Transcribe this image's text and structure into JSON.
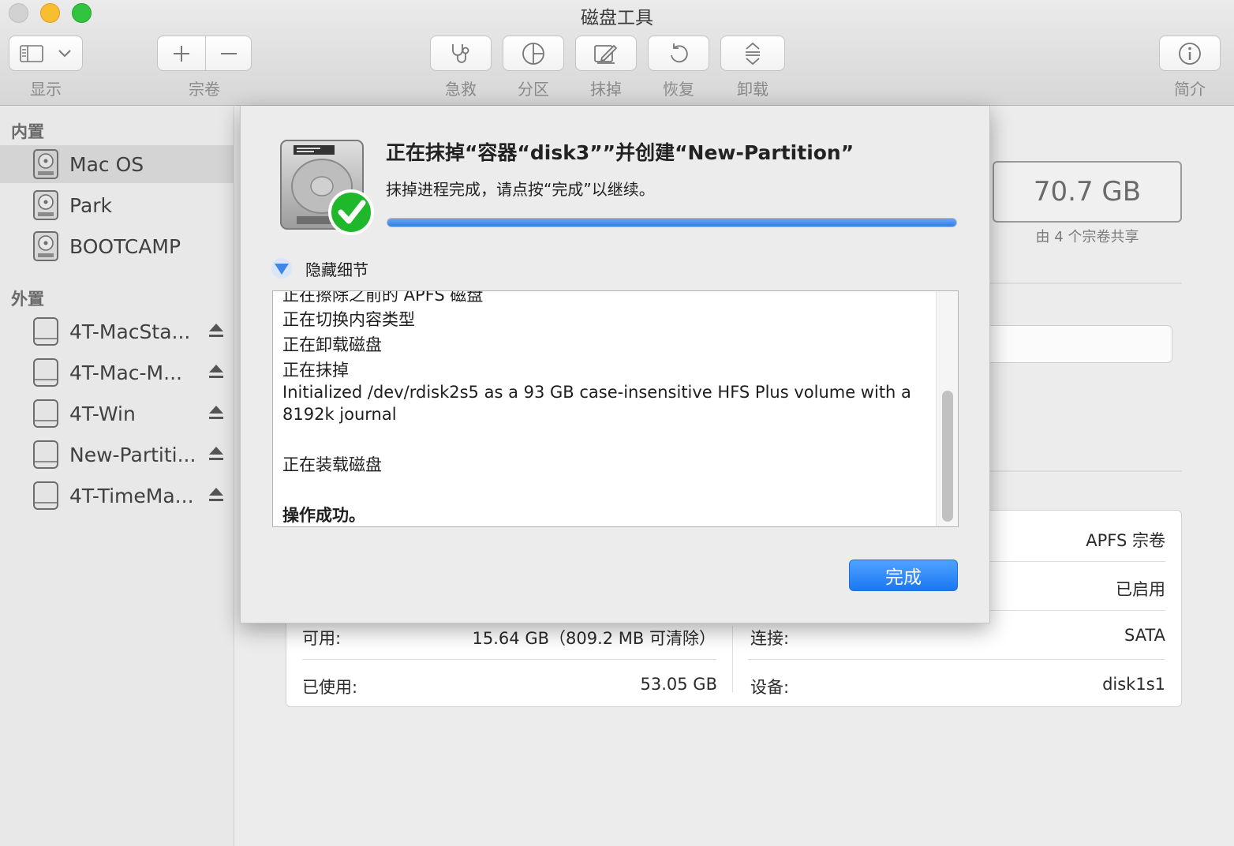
{
  "window": {
    "title": "磁盘工具"
  },
  "toolbar": {
    "view_label": "显示",
    "volume_label": "宗卷",
    "first_aid_label": "急救",
    "partition_label": "分区",
    "erase_label": "抹掉",
    "restore_label": "恢复",
    "unmount_label": "卸载",
    "info_label": "简介"
  },
  "sidebar": {
    "internal_header": "内置",
    "external_header": "外置",
    "internal": [
      {
        "label": "Mac OS",
        "selected": true
      },
      {
        "label": "Park"
      },
      {
        "label": "BOOTCAMP"
      }
    ],
    "external": [
      {
        "label": "4T-MacSta..."
      },
      {
        "label": "4T-Mac-M..."
      },
      {
        "label": "4T-Win"
      },
      {
        "label": "New-Partiti..."
      },
      {
        "label": "4T-TimeMa..."
      }
    ]
  },
  "main": {
    "capacity": "70.7 GB",
    "shared_text": "由 4 个宗卷共享",
    "info": {
      "type_value": "APFS 宗卷",
      "status_value": "已启用",
      "available_label": "可用:",
      "available_value": "15.64 GB（809.2 MB 可清除）",
      "used_label": "已使用:",
      "used_value": "53.05 GB",
      "connection_label": "连接:",
      "connection_value": "SATA",
      "device_label": "设备:",
      "device_value": "disk1s1"
    }
  },
  "sheet": {
    "title": "正在抹掉“容器“disk3””并创建“New-Partition”",
    "subtitle": "抹掉进程完成，请点按“完成”以继续。",
    "progress": 1.0,
    "details_label": "隐藏细节",
    "log": [
      "正在擦除之前的 APFS 磁盘",
      "正在切换内容类型",
      "正在卸载磁盘",
      "正在抹掉",
      "Initialized /dev/rdisk2s5 as a 93 GB case-insensitive HFS Plus volume with a",
      "8192k journal",
      "正在装载磁盘",
      "操作成功。"
    ],
    "done_label": "完成"
  },
  "colors": {
    "accent": "#1a78f2",
    "progress": "#2f7ee9",
    "check": "#1fb82a"
  }
}
